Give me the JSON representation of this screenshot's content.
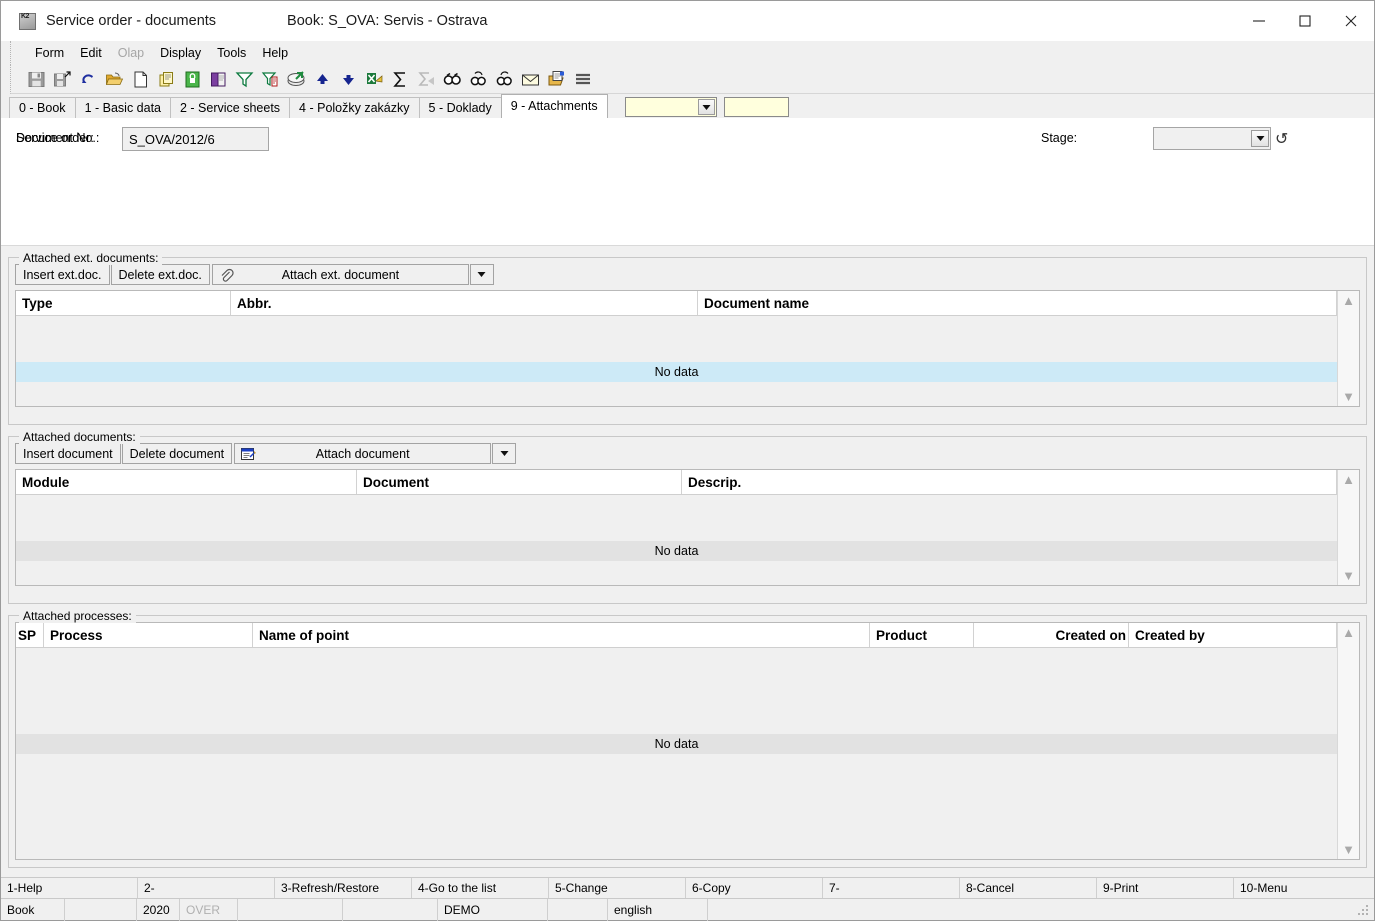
{
  "window": {
    "title": "Service order - documents",
    "book_title": "Book: S_OVA: Servis - Ostrava",
    "app_icon": "k2-app-icon",
    "minimize": "minimize-icon",
    "maximize": "maximize-icon",
    "close": "close-icon"
  },
  "menu": {
    "items": [
      {
        "label": "Form",
        "disabled": false
      },
      {
        "label": "Edit",
        "disabled": false
      },
      {
        "label": "Olap",
        "disabled": true
      },
      {
        "label": "Display",
        "disabled": false
      },
      {
        "label": "Tools",
        "disabled": false
      },
      {
        "label": "Help",
        "disabled": false
      }
    ]
  },
  "toolbar": {
    "buttons": [
      {
        "name": "save-icon"
      },
      {
        "name": "save-and-exit-icon"
      },
      {
        "name": "undo-icon"
      },
      {
        "name": "open-folder-icon"
      },
      {
        "name": "new-document-icon"
      },
      {
        "name": "copy-document-icon"
      },
      {
        "name": "lock-icon"
      },
      {
        "name": "book-icon"
      },
      {
        "name": "filter-icon"
      },
      {
        "name": "filter-edit-icon"
      },
      {
        "name": "print-icon"
      },
      {
        "name": "move-up-icon"
      },
      {
        "name": "move-down-icon"
      },
      {
        "name": "export-excel-icon"
      },
      {
        "name": "sum-icon"
      },
      {
        "name": "sum-clear-icon"
      },
      {
        "name": "find-icon"
      },
      {
        "name": "find-previous-icon"
      },
      {
        "name": "find-next-icon"
      },
      {
        "name": "mail-icon"
      },
      {
        "name": "notes-icon"
      },
      {
        "name": "menu-list-icon"
      }
    ]
  },
  "tabs": {
    "items": [
      {
        "label": "0 - Book",
        "active": false
      },
      {
        "label": "1 - Basic data",
        "active": false
      },
      {
        "label": "2 - Service sheets",
        "active": false
      },
      {
        "label": "4 - Položky zakázky",
        "active": false
      },
      {
        "label": "5 - Doklady",
        "active": false
      },
      {
        "label": "9 - Attachments",
        "active": true
      }
    ],
    "quick_combo_value": "",
    "quick_field_value": ""
  },
  "header": {
    "label_service_order": "Service order:",
    "label_document_no": "Document No.:",
    "document_no_value": "S_OVA/2012/6",
    "stage_label": "Stage:",
    "stage_value": "",
    "history_icon": "history-undo-icon"
  },
  "ext_documents": {
    "group_title": "Attached ext. documents:",
    "insert_label": "Insert ext.doc.",
    "delete_label": "Delete ext.doc.",
    "attach_label": "Attach ext. document",
    "attach_icon": "paperclip-icon",
    "dropdown_icon": "chevron-down-icon",
    "columns": [
      "Type",
      "Abbr.",
      "Document name"
    ],
    "rows": [],
    "empty_text": "No data"
  },
  "documents": {
    "group_title": "Attached documents:",
    "insert_label": "Insert document",
    "delete_label": "Delete document",
    "attach_label": "Attach document",
    "attach_icon": "document-link-icon",
    "dropdown_icon": "chevron-down-icon",
    "columns": [
      "Module",
      "Document",
      "Descrip."
    ],
    "rows": [],
    "empty_text": "No data"
  },
  "processes": {
    "group_title": "Attached processes:",
    "columns": [
      "SP",
      "Process",
      "Name of point",
      "Product",
      "Created on",
      "Created by"
    ],
    "rows": [],
    "empty_text": "No data"
  },
  "function_keys": [
    "1-Help",
    "2-",
    "3-Refresh/Restore",
    "4-Go to the list",
    "5-Change",
    "6-Copy",
    "7-",
    "8-Cancel",
    "9-Print",
    "10-Menu"
  ],
  "statusbar": {
    "mode": "Book",
    "year": "2020",
    "overwrite": "OVER",
    "blank1": "",
    "database": "DEMO",
    "blank2": "",
    "language": "english",
    "blank3": ""
  },
  "colors": {
    "accent_selection": "#cdeaf7",
    "window_bg": "#f0f0f0",
    "field_yellow": "#ffffdd"
  }
}
